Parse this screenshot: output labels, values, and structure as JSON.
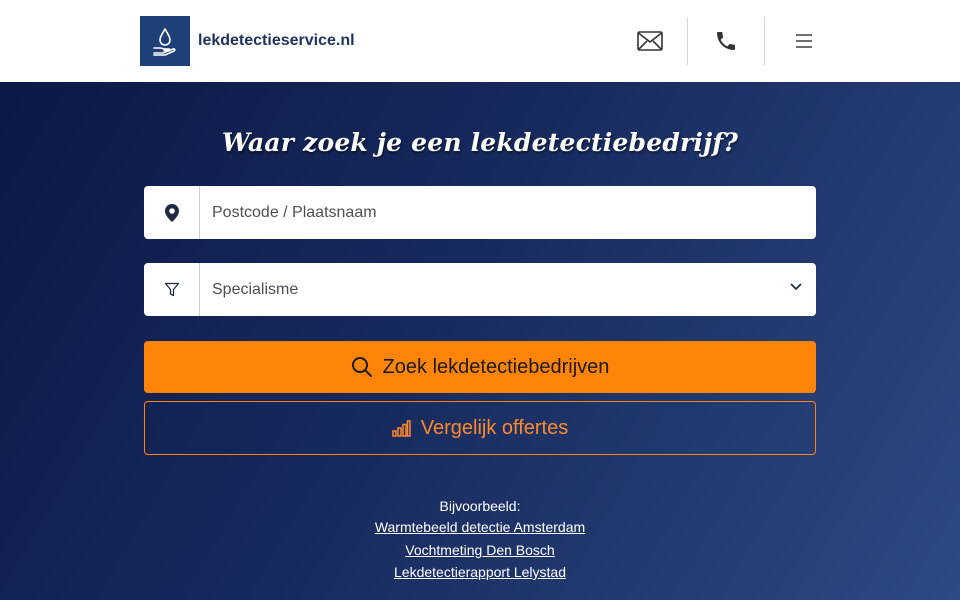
{
  "header": {
    "logo_text": "lekdetectieservice.nl",
    "mail_icon": "envelope-icon",
    "phone_icon": "phone-icon",
    "menu_icon": "hamburger-menu-icon"
  },
  "hero": {
    "title": "Waar zoek je een lekdetectiebedrijf?",
    "location_placeholder": "Postcode / Plaatsnaam",
    "location_value": "",
    "specialism_value": "Specialisme",
    "search_button": "Zoek lekdetectiebedrijven",
    "compare_button": "Vergelijk offertes",
    "examples_label": "Bijvoorbeeld:",
    "examples": [
      "Warmtebeeld detectie Amsterdam",
      "Vochtmeting Den Bosch",
      "Lekdetectierapport Lelystad"
    ]
  },
  "colors": {
    "accent": "#ff8408",
    "brand": "#1f3f78",
    "hero_dark": "#0c1845",
    "hero_light": "#2d4a82"
  }
}
